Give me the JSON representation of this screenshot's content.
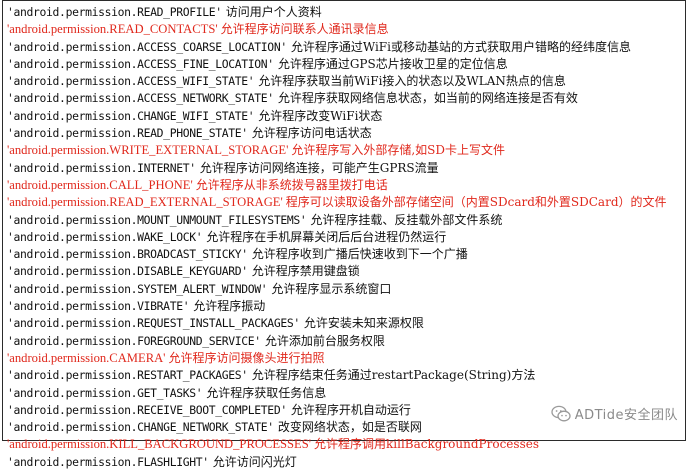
{
  "lines": [
    {
      "perm": "'android.permission.READ_PROFILE'",
      "desc": "访问用户个人资料",
      "highlight": false
    },
    {
      "perm": "'android.permission.READ_CONTACTS'",
      "desc": "允许程序访问联系人通讯录信息",
      "highlight": true
    },
    {
      "perm": "'android.permission.ACCESS_COARSE_LOCATION'",
      "desc": "允许程序通过WiFi或移动基站的方式获取用户错略的经纬度信息",
      "highlight": false
    },
    {
      "perm": "'android.permission.ACCESS_FINE_LOCATION'",
      "desc": "允许程序通过GPS芯片接收卫星的定位信息",
      "highlight": false
    },
    {
      "perm": "'android.permission.ACCESS_WIFI_STATE'",
      "desc": "允许程序获取当前WiFi接入的状态以及WLAN热点的信息",
      "highlight": false
    },
    {
      "perm": "'android.permission.ACCESS_NETWORK_STATE'",
      "desc": "允许程序获取网络信息状态，如当前的网络连接是否有效",
      "highlight": false
    },
    {
      "perm": "'android.permission.CHANGE_WIFI_STATE'",
      "desc": "允许程序改变WiFi状态",
      "highlight": false
    },
    {
      "perm": "'android.permission.READ_PHONE_STATE'",
      "desc": "允许程序访问电话状态",
      "highlight": false
    },
    {
      "perm": "'android.permission.WRITE_EXTERNAL_STORAGE'",
      "desc": "允许程序写入外部存储,如SD卡上写文件",
      "highlight": true
    },
    {
      "perm": "'android.permission.INTERNET'",
      "desc": "允许程序访问网络连接，可能产生GPRS流量",
      "highlight": false
    },
    {
      "perm": "'android.permission.CALL_PHONE'",
      "desc": "允许程序从非系统拨号器里拨打电话",
      "highlight": true
    },
    {
      "perm": "'android.permission.READ_EXTERNAL_STORAGE'",
      "desc": "程序可以读取设备外部存储空间（内置SDcard和外置SDCard）的文件",
      "highlight": true
    },
    {
      "perm": "'android.permission.MOUNT_UNMOUNT_FILESYSTEMS'",
      "desc": "允许程序挂载、反挂载外部文件系统",
      "highlight": false
    },
    {
      "perm": "'android.permission.WAKE_LOCK'",
      "desc": "允许程序在手机屏幕关闭后后台进程仍然运行",
      "highlight": false
    },
    {
      "perm": "'android.permission.BROADCAST_STICKY'",
      "desc": "允许程序收到广播后快速收到下一个广播",
      "highlight": false
    },
    {
      "perm": "'android.permission.DISABLE_KEYGUARD'",
      "desc": "允许程序禁用键盘锁",
      "highlight": false
    },
    {
      "perm": "'android.permission.SYSTEM_ALERT_WINDOW'",
      "desc": "允许程序显示系统窗口",
      "highlight": false
    },
    {
      "perm": "'android.permission.VIBRATE'",
      "desc": "允许程序振动",
      "highlight": false
    },
    {
      "perm": "'android.permission.REQUEST_INSTALL_PACKAGES'",
      "desc": "允许安装未知来源权限",
      "highlight": false
    },
    {
      "perm": "'android.permission.FOREGROUND_SERVICE'",
      "desc": "允许添加前台服务权限",
      "highlight": false
    },
    {
      "perm": "'android.permission.CAMERA'",
      "desc": "允许程序访问摄像头进行拍照",
      "highlight": true
    },
    {
      "perm": "'android.permission.RESTART_PACKAGES'",
      "desc": "允许程序结束任务通过restartPackage(String)方法",
      "highlight": false
    },
    {
      "perm": "'android.permission.GET_TASKS'",
      "desc": "允许程序获取任务信息",
      "highlight": false
    },
    {
      "perm": "'android.permission.RECEIVE_BOOT_COMPLETED'",
      "desc": "允许程序开机自动运行",
      "highlight": false
    },
    {
      "perm": "'android.permission.CHANGE_NETWORK_STATE'",
      "desc": "改变网络状态，如是否联网",
      "highlight": false
    },
    {
      "perm": "'android.permission.KILL_BACKGROUND_PROCESSES'",
      "desc": "允许程序调用killBackgroundProcesses",
      "highlight": true
    },
    {
      "perm": "'android.permission.FLASHLIGHT'",
      "desc": "允许访问闪光灯",
      "highlight": false
    }
  ],
  "watermark": {
    "text": "ADTide安全团队",
    "icon": "wechat-icon",
    "color": "#8a8a8a"
  },
  "colors": {
    "text": "#111111",
    "highlight": "#e0281c",
    "border": "#2b2b2b"
  }
}
